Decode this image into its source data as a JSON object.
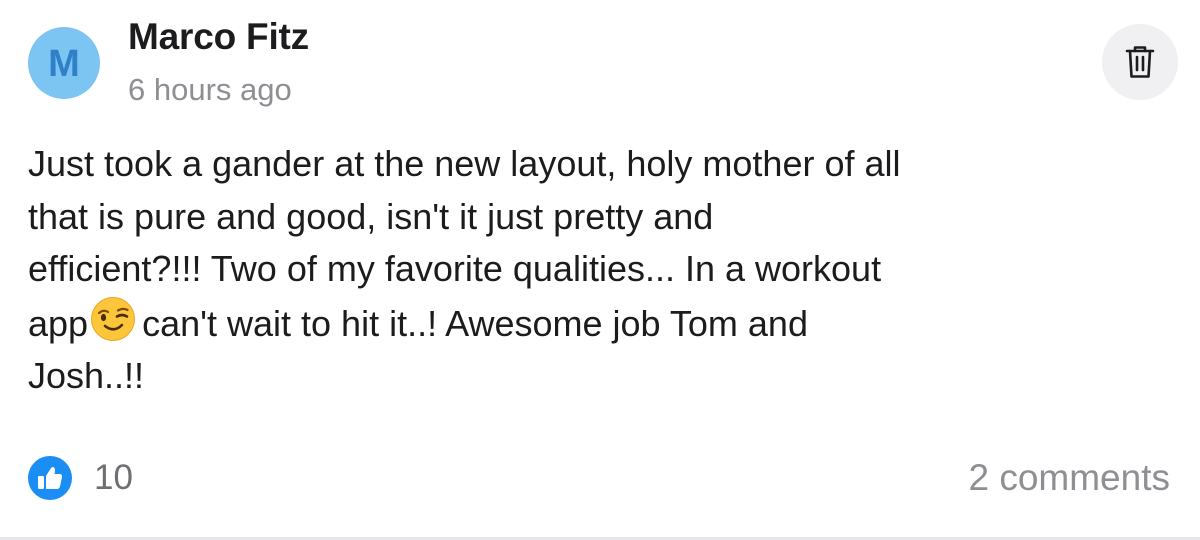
{
  "post": {
    "author": {
      "initial": "M",
      "name": "Marco Fitz"
    },
    "timestamp": "6 hours ago",
    "body": {
      "before_emoji": "Just took a gander at the new layout, holy mother of all\nthat is pure and good, isn't it just pretty and\nefficient?!!! Two of my favorite qualities... In a workout\napp",
      "emoji": "winking-face",
      "after_emoji": "can't wait to hit it..! Awesome job Tom and\nJosh..!!"
    },
    "likes": {
      "count": "10",
      "icon": "thumbs-up-icon"
    },
    "comments_label": "2 comments",
    "delete_icon": "trash-icon"
  },
  "colors": {
    "avatar_bg": "#7cc4f2",
    "avatar_letter": "#2f7fc9",
    "like_blue": "#1a8ef5",
    "muted_text": "#8e8e93"
  }
}
